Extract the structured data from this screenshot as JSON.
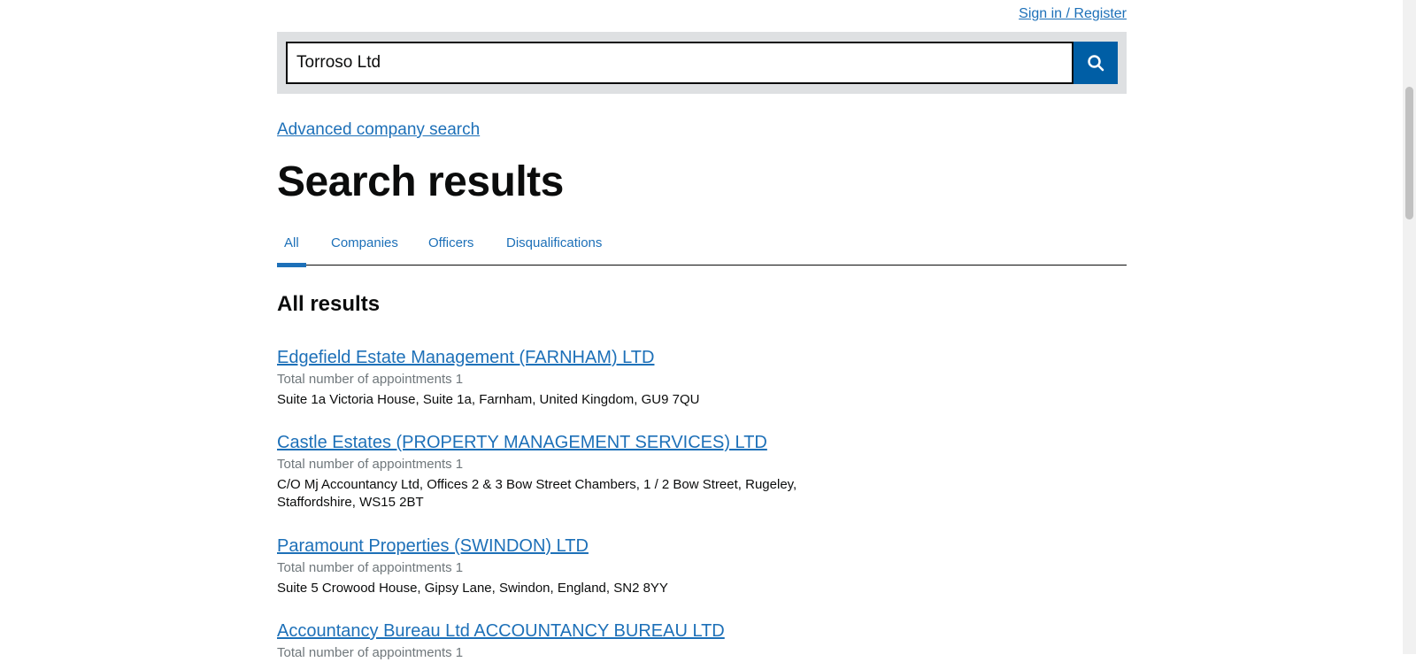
{
  "header": {
    "signin_label": "Sign in / Register"
  },
  "search": {
    "value": "Torroso Ltd",
    "button_icon": "search-icon"
  },
  "advanced_search_label": "Advanced company search",
  "page_title": "Search results",
  "tabs": [
    {
      "label": "All",
      "active": true
    },
    {
      "label": "Companies",
      "active": false
    },
    {
      "label": "Officers",
      "active": false
    },
    {
      "label": "Disqualifications",
      "active": false
    }
  ],
  "section_heading": "All results",
  "results": [
    {
      "title": "Edgefield Estate Management (FARNHAM) LTD",
      "meta": "Total number of appointments 1",
      "address": "Suite 1a Victoria House, Suite 1a, Farnham, United Kingdom, GU9 7QU"
    },
    {
      "title": "Castle Estates (PROPERTY MANAGEMENT SERVICES) LTD",
      "meta": "Total number of appointments 1",
      "address": "C/O Mj Accountancy Ltd, Offices 2 & 3 Bow Street Chambers, 1 / 2 Bow Street, Rugeley, Staffordshire, WS15 2BT"
    },
    {
      "title": "Paramount Properties (SWINDON) LTD",
      "meta": "Total number of appointments 1",
      "address": "Suite 5 Crowood House, Gipsy Lane, Swindon, England, SN2 8YY"
    },
    {
      "title": "Accountancy Bureau Ltd ACCOUNTANCY BUREAU LTD",
      "meta": "Total number of appointments 1",
      "address": ""
    }
  ],
  "colors": {
    "link": "#1d70b8",
    "search_button": "#005ea5",
    "search_background": "#dee0e2",
    "text": "#0b0c0c",
    "meta_text": "#6f777b"
  }
}
